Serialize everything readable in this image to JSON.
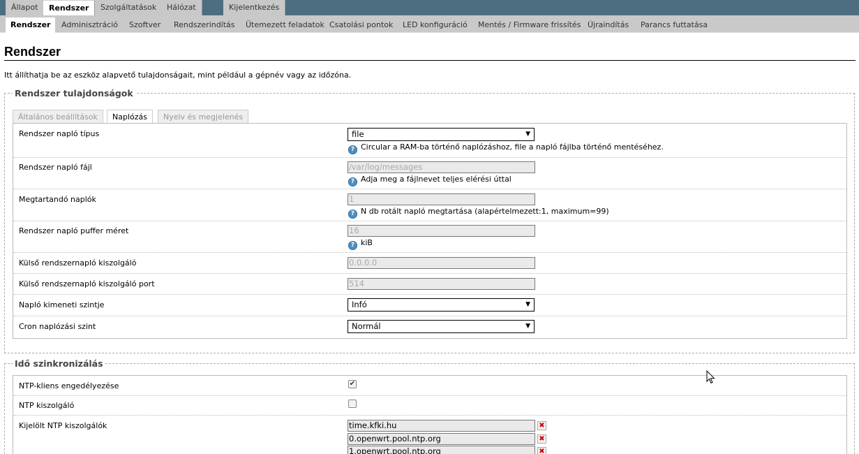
{
  "top_menu": [
    "Állapot",
    "Rendszer",
    "Szolgáltatások",
    "Hálózat",
    "Kijelentkezés"
  ],
  "sub_menu": [
    "Rendszer",
    "Adminisztráció",
    "Szoftver",
    "Rendszerindítás",
    "Ütemezett feladatok",
    "Csatolási pontok",
    "LED konfiguráció",
    "Mentés / Firmware frissítés",
    "Újraindítás",
    "Parancs futtatása"
  ],
  "page": {
    "title": "Rendszer",
    "description": "Itt állíthatja be az eszköz alapvető tulajdonságait, mint például a gépnév vagy az időzóna."
  },
  "props": {
    "legend": "Rendszer tulajdonságok",
    "tabs": [
      "Általános beállítások",
      "Naplózás",
      "Nyelv és megjelenés"
    ],
    "rows": [
      {
        "label": "Rendszer napló típus",
        "value": "file",
        "hint": "Circular a RAM-ba történő naplózáshoz, file a napló fájlba történő mentéséhez."
      },
      {
        "label": "Rendszer napló fájl",
        "placeholder": "/var/log/messages",
        "hint": "Adja meg a fájlnevet teljes elérési úttal"
      },
      {
        "label": "Megtartandó naplók",
        "placeholder": "1",
        "hint": "N db rotált napló megtartása (alapértelmezett:1, maximum=99)"
      },
      {
        "label": "Rendszer napló puffer méret",
        "placeholder": "16",
        "hint": "kiB"
      },
      {
        "label": "Külső rendszernapló kiszolgáló",
        "placeholder": "0.0.0.0"
      },
      {
        "label": "Külső rendszernapló kiszolgáló port",
        "placeholder": "514"
      },
      {
        "label": "Napló kimeneti szintje",
        "value": "Infó"
      },
      {
        "label": "Cron naplózási szint",
        "value": "Normál"
      }
    ]
  },
  "ntp": {
    "legend": "Idő szinkronizálás",
    "enable_label": "NTP-kliens engedélyezése",
    "enable_checked": true,
    "server_label": "NTP kiszolgáló",
    "server_checked": false,
    "servers_label": "Kijelölt NTP kiszolgálók",
    "servers": [
      "time.kfki.hu",
      "0.openwrt.pool.ntp.org",
      "1.openwrt.pool.ntp.org"
    ]
  },
  "icons": {
    "help": "help-icon",
    "delete": "delete-icon",
    "dropdown": "chevron-down-icon",
    "checkmark": "checkmark-icon",
    "cursor": "mouse-pointer-icon"
  },
  "colors": {
    "topbar": "#4d6d80",
    "menu_bg": "#c9c9c9",
    "help_icon": "#4a90c8",
    "delete_x": "#cc0000"
  }
}
